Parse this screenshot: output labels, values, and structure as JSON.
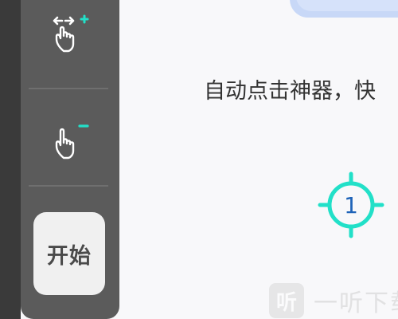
{
  "toolbar": {
    "add_target_icon": "hand-pointer-plus-icon",
    "remove_target_icon": "hand-pointer-minus-icon",
    "start_label": "开始"
  },
  "main": {
    "description": "自动点击神器，快",
    "target_marker": {
      "number": "1",
      "color": "#22e0c8",
      "number_color": "#1e63b8"
    }
  },
  "watermark": {
    "logo_text": "听",
    "text": "一听下载"
  },
  "colors": {
    "panel": "#5b5b5b",
    "accent": "#22e0c8",
    "start_button_bg": "#f0f0f0"
  }
}
